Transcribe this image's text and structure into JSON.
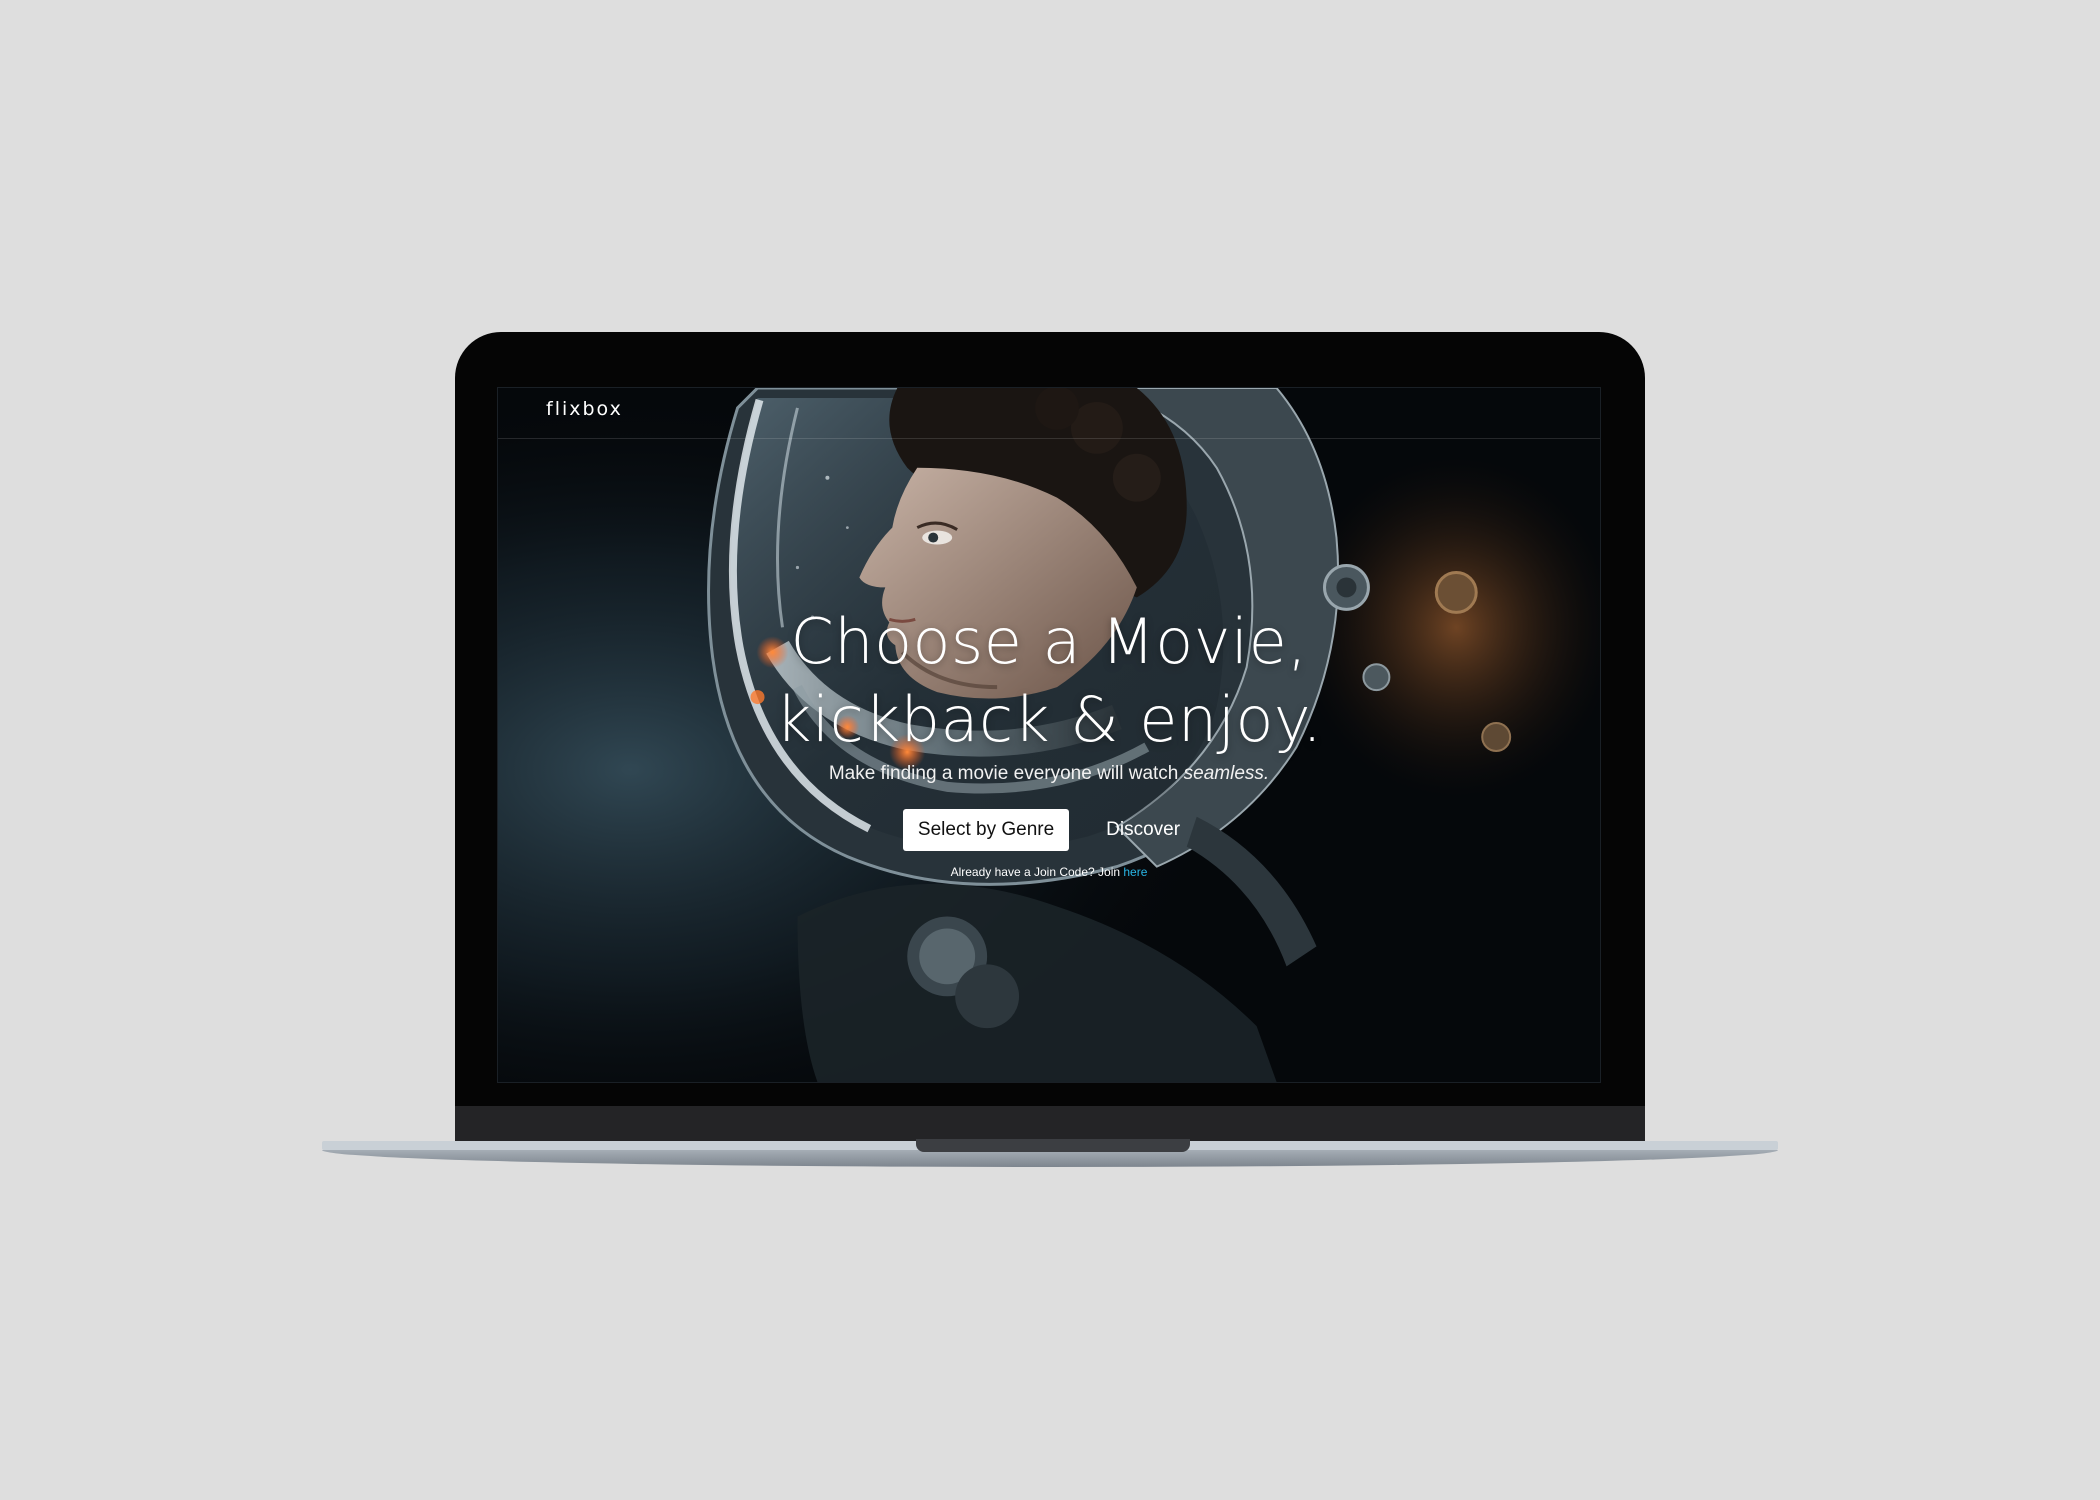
{
  "app": {
    "brand": "flixbox"
  },
  "hero": {
    "headline_line1": "Choose a Movie,",
    "headline_line2": "kickback & enjoy.",
    "subline_prefix": "Make finding a movie everyone will watch ",
    "subline_emphasis": "seamless."
  },
  "actions": {
    "primary_label": "Select by Genre",
    "secondary_label": "Discover"
  },
  "join": {
    "prompt": "Already have a Join Code? Join ",
    "link_label": "here"
  },
  "colors": {
    "background": "#dedede",
    "bezel": "#050505",
    "screen_dark": "#05080b",
    "link_accent": "#29b6e6",
    "primary_button_bg": "#ffffff"
  },
  "icons": {
    "hero_image": "astronaut-helmet-illustration"
  }
}
